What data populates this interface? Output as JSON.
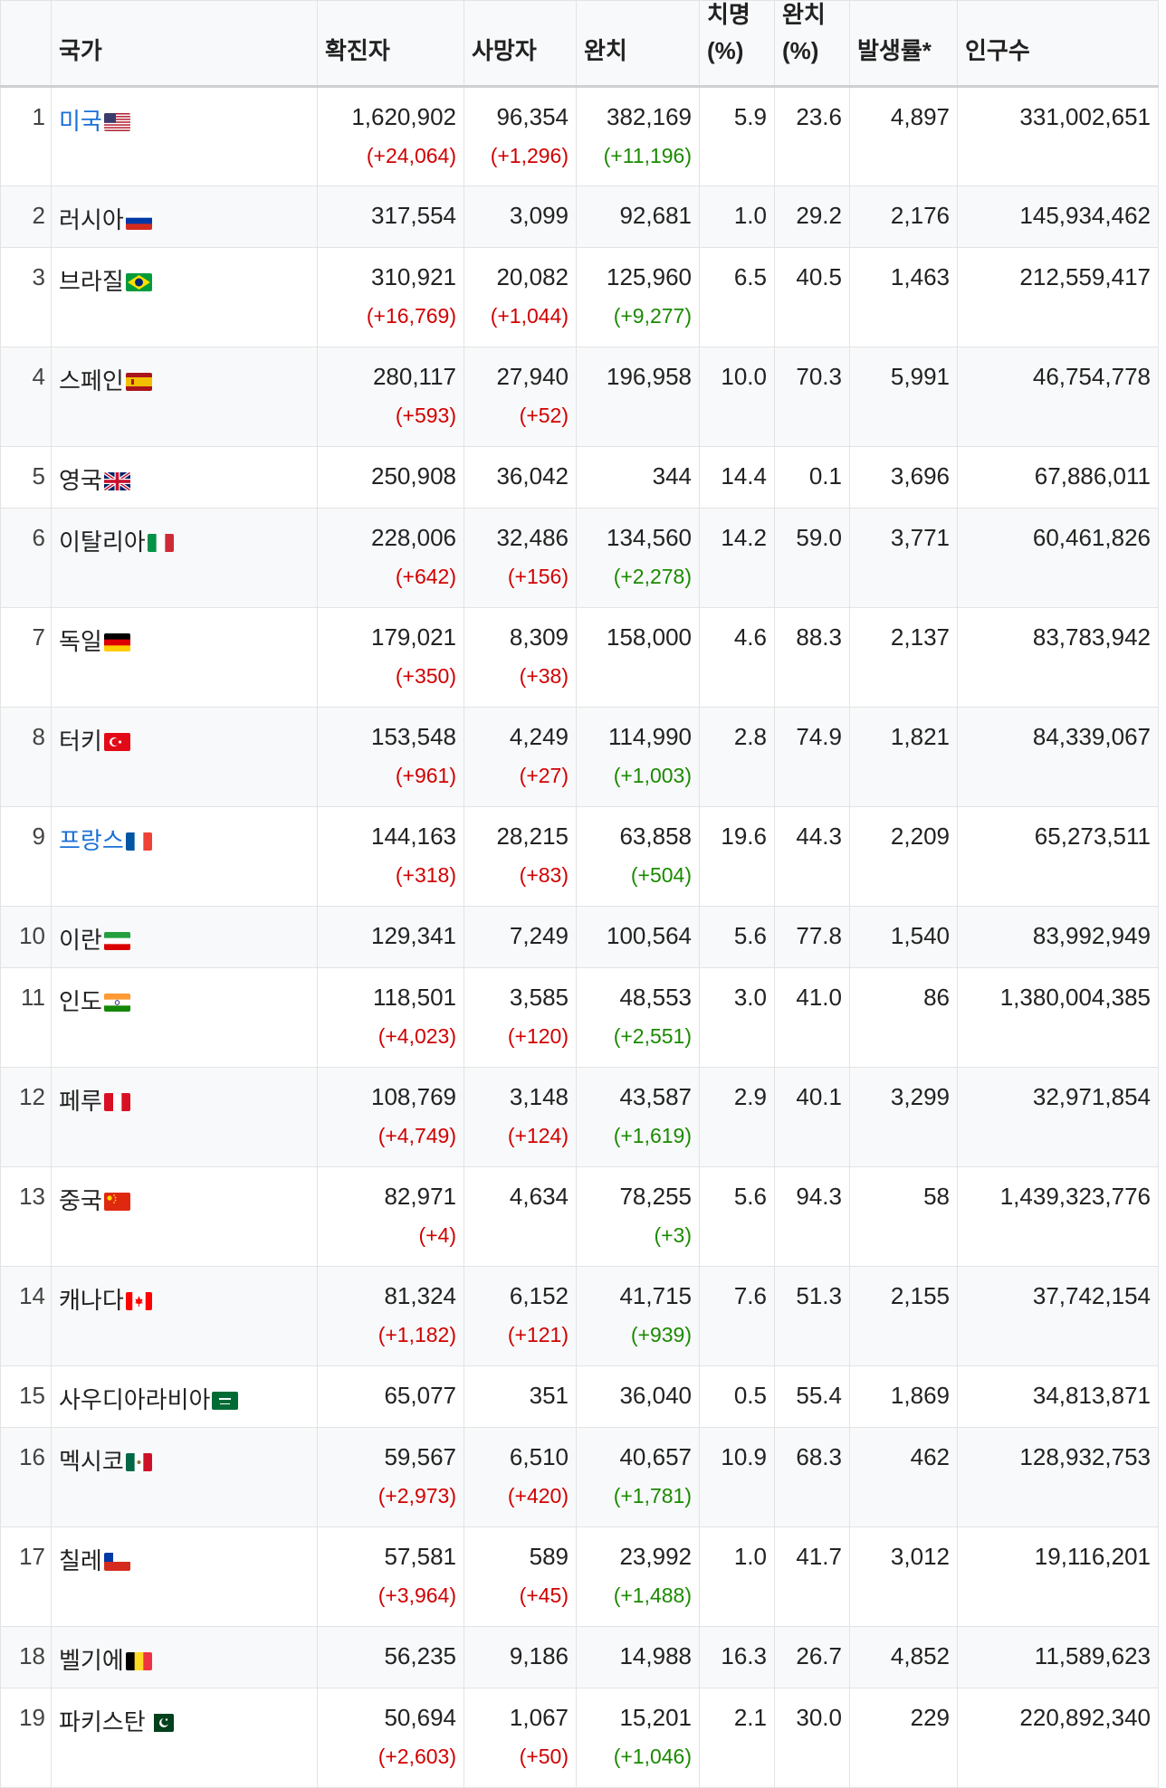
{
  "headers": {
    "country": "국가",
    "confirmed": "확진자",
    "deaths": "사망자",
    "recovered": "완치",
    "fatality_top": "치명",
    "fatality_unit": "(%)",
    "recovery_top": "완치",
    "recovery_unit": "(%)",
    "incidence": "발생률*",
    "population": "인구수"
  },
  "flag_colors": {
    "us": [
      "#b22234",
      "#ffffff",
      "#3c3b6e"
    ],
    "ru": [
      "#ffffff",
      "#0039a6",
      "#d52b1e"
    ],
    "br": [
      "#009c3b",
      "#ffdf00",
      "#002776"
    ],
    "es": [
      "#aa151b",
      "#f1bf00"
    ],
    "gb": [
      "#012169",
      "#ffffff",
      "#c8102e"
    ],
    "it": [
      "#009246",
      "#ffffff",
      "#ce2b37"
    ],
    "de": [
      "#000000",
      "#dd0000",
      "#ffce00"
    ],
    "tr": [
      "#e30a17",
      "#ffffff"
    ],
    "fr": [
      "#0055a4",
      "#ffffff",
      "#ef4135"
    ],
    "ir": [
      "#239f40",
      "#ffffff",
      "#da0000"
    ],
    "in": [
      "#ff9933",
      "#ffffff",
      "#138808"
    ],
    "pe": [
      "#d91023",
      "#ffffff"
    ],
    "cn": [
      "#de2910",
      "#ffde00"
    ],
    "ca": [
      "#ff0000",
      "#ffffff"
    ],
    "sa": [
      "#006c35",
      "#ffffff"
    ],
    "mx": [
      "#006847",
      "#ffffff",
      "#ce1126"
    ],
    "cl": [
      "#ffffff",
      "#d52b1e",
      "#0039a6"
    ],
    "be": [
      "#000000",
      "#fdda24",
      "#ef3340"
    ],
    "pk": [
      "#01411c",
      "#ffffff"
    ]
  },
  "rows": [
    {
      "rank": "1",
      "country": "미국",
      "flag": "us",
      "link": true,
      "confirmed": "1,620,902",
      "confirmed_change": "(+24,064)",
      "deaths": "96,354",
      "deaths_change": "(+1,296)",
      "recovered": "382,169",
      "recovered_change": "(+11,196)",
      "fatality": "5.9",
      "recovery": "23.6",
      "incidence": "4,897",
      "population": "331,002,651"
    },
    {
      "rank": "2",
      "country": "러시아",
      "flag": "ru",
      "link": false,
      "confirmed": "317,554",
      "confirmed_change": "",
      "deaths": "3,099",
      "deaths_change": "",
      "recovered": "92,681",
      "recovered_change": "",
      "fatality": "1.0",
      "recovery": "29.2",
      "incidence": "2,176",
      "population": "145,934,462"
    },
    {
      "rank": "3",
      "country": "브라질",
      "flag": "br",
      "link": false,
      "confirmed": "310,921",
      "confirmed_change": "(+16,769)",
      "deaths": "20,082",
      "deaths_change": "(+1,044)",
      "recovered": "125,960",
      "recovered_change": "(+9,277)",
      "fatality": "6.5",
      "recovery": "40.5",
      "incidence": "1,463",
      "population": "212,559,417"
    },
    {
      "rank": "4",
      "country": "스페인",
      "flag": "es",
      "link": false,
      "confirmed": "280,117",
      "confirmed_change": "(+593)",
      "deaths": "27,940",
      "deaths_change": "(+52)",
      "recovered": "196,958",
      "recovered_change": "",
      "fatality": "10.0",
      "recovery": "70.3",
      "incidence": "5,991",
      "population": "46,754,778"
    },
    {
      "rank": "5",
      "country": "영국",
      "flag": "gb",
      "link": false,
      "confirmed": "250,908",
      "confirmed_change": "",
      "deaths": "36,042",
      "deaths_change": "",
      "recovered": "344",
      "recovered_change": "",
      "fatality": "14.4",
      "recovery": "0.1",
      "incidence": "3,696",
      "population": "67,886,011"
    },
    {
      "rank": "6",
      "country": "이탈리아",
      "flag": "it",
      "link": false,
      "confirmed": "228,006",
      "confirmed_change": "(+642)",
      "deaths": "32,486",
      "deaths_change": "(+156)",
      "recovered": "134,560",
      "recovered_change": "(+2,278)",
      "fatality": "14.2",
      "recovery": "59.0",
      "incidence": "3,771",
      "population": "60,461,826"
    },
    {
      "rank": "7",
      "country": "독일",
      "flag": "de",
      "link": false,
      "confirmed": "179,021",
      "confirmed_change": "(+350)",
      "deaths": "8,309",
      "deaths_change": "(+38)",
      "recovered": "158,000",
      "recovered_change": "",
      "fatality": "4.6",
      "recovery": "88.3",
      "incidence": "2,137",
      "population": "83,783,942"
    },
    {
      "rank": "8",
      "country": "터키",
      "flag": "tr",
      "link": false,
      "confirmed": "153,548",
      "confirmed_change": "(+961)",
      "deaths": "4,249",
      "deaths_change": "(+27)",
      "recovered": "114,990",
      "recovered_change": "(+1,003)",
      "fatality": "2.8",
      "recovery": "74.9",
      "incidence": "1,821",
      "population": "84,339,067"
    },
    {
      "rank": "9",
      "country": "프랑스",
      "flag": "fr",
      "link": true,
      "confirmed": "144,163",
      "confirmed_change": "(+318)",
      "deaths": "28,215",
      "deaths_change": "(+83)",
      "recovered": "63,858",
      "recovered_change": "(+504)",
      "fatality": "19.6",
      "recovery": "44.3",
      "incidence": "2,209",
      "population": "65,273,511"
    },
    {
      "rank": "10",
      "country": "이란",
      "flag": "ir",
      "link": false,
      "confirmed": "129,341",
      "confirmed_change": "",
      "deaths": "7,249",
      "deaths_change": "",
      "recovered": "100,564",
      "recovered_change": "",
      "fatality": "5.6",
      "recovery": "77.8",
      "incidence": "1,540",
      "population": "83,992,949"
    },
    {
      "rank": "11",
      "country": "인도",
      "flag": "in",
      "link": false,
      "confirmed": "118,501",
      "confirmed_change": "(+4,023)",
      "deaths": "3,585",
      "deaths_change": "(+120)",
      "recovered": "48,553",
      "recovered_change": "(+2,551)",
      "fatality": "3.0",
      "recovery": "41.0",
      "incidence": "86",
      "population": "1,380,004,385"
    },
    {
      "rank": "12",
      "country": "페루",
      "flag": "pe",
      "link": false,
      "confirmed": "108,769",
      "confirmed_change": "(+4,749)",
      "deaths": "3,148",
      "deaths_change": "(+124)",
      "recovered": "43,587",
      "recovered_change": "(+1,619)",
      "fatality": "2.9",
      "recovery": "40.1",
      "incidence": "3,299",
      "population": "32,971,854"
    },
    {
      "rank": "13",
      "country": "중국",
      "flag": "cn",
      "link": false,
      "confirmed": "82,971",
      "confirmed_change": "(+4)",
      "deaths": "4,634",
      "deaths_change": "",
      "recovered": "78,255",
      "recovered_change": "(+3)",
      "fatality": "5.6",
      "recovery": "94.3",
      "incidence": "58",
      "population": "1,439,323,776"
    },
    {
      "rank": "14",
      "country": "캐나다",
      "flag": "ca",
      "link": false,
      "confirmed": "81,324",
      "confirmed_change": "(+1,182)",
      "deaths": "6,152",
      "deaths_change": "(+121)",
      "recovered": "41,715",
      "recovered_change": "(+939)",
      "fatality": "7.6",
      "recovery": "51.3",
      "incidence": "2,155",
      "population": "37,742,154"
    },
    {
      "rank": "15",
      "country": "사우디아라비아",
      "flag": "sa",
      "link": false,
      "confirmed": "65,077",
      "confirmed_change": "",
      "deaths": "351",
      "deaths_change": "",
      "recovered": "36,040",
      "recovered_change": "",
      "fatality": "0.5",
      "recovery": "55.4",
      "incidence": "1,869",
      "population": "34,813,871"
    },
    {
      "rank": "16",
      "country": "멕시코",
      "flag": "mx",
      "link": false,
      "confirmed": "59,567",
      "confirmed_change": "(+2,973)",
      "deaths": "6,510",
      "deaths_change": "(+420)",
      "recovered": "40,657",
      "recovered_change": "(+1,781)",
      "fatality": "10.9",
      "recovery": "68.3",
      "incidence": "462",
      "population": "128,932,753"
    },
    {
      "rank": "17",
      "country": "칠레",
      "flag": "cl",
      "link": false,
      "confirmed": "57,581",
      "confirmed_change": "(+3,964)",
      "deaths": "589",
      "deaths_change": "(+45)",
      "recovered": "23,992",
      "recovered_change": "(+1,488)",
      "fatality": "1.0",
      "recovery": "41.7",
      "incidence": "3,012",
      "population": "19,116,201"
    },
    {
      "rank": "18",
      "country": "벨기에",
      "flag": "be",
      "link": false,
      "confirmed": "56,235",
      "confirmed_change": "",
      "deaths": "9,186",
      "deaths_change": "",
      "recovered": "14,988",
      "recovered_change": "",
      "fatality": "16.3",
      "recovery": "26.7",
      "incidence": "4,852",
      "population": "11,589,623"
    },
    {
      "rank": "19",
      "country": "파키스탄",
      "flag": "pk",
      "link": false,
      "confirmed": "50,694",
      "confirmed_change": "(+2,603)",
      "deaths": "1,067",
      "deaths_change": "(+50)",
      "recovered": "15,201",
      "recovered_change": "(+1,046)",
      "fatality": "2.1",
      "recovery": "30.0",
      "incidence": "229",
      "population": "220,892,340"
    }
  ]
}
